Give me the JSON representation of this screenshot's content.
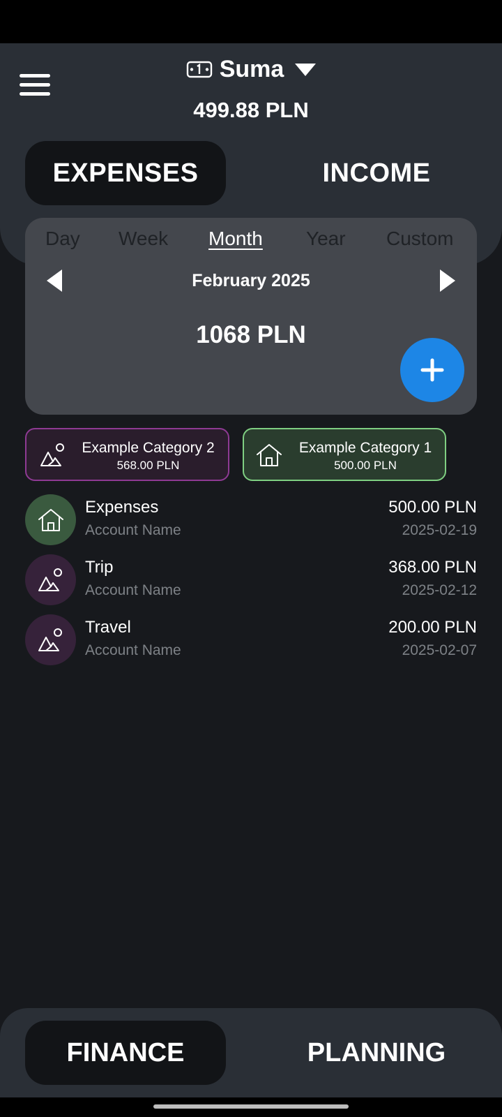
{
  "header": {
    "account_name": "Suma",
    "account_balance": "499.88 PLN",
    "wallet_icon": "wallet-icon",
    "tabs": [
      {
        "label": "EXPENSES",
        "active": true
      },
      {
        "label": "INCOME",
        "active": false
      }
    ]
  },
  "period": {
    "tabs": [
      "Day",
      "Week",
      "Month",
      "Year",
      "Custom"
    ],
    "active_tab": "Month",
    "label": "February 2025",
    "total": "1068 PLN"
  },
  "categories": [
    {
      "name": "Example Category 2",
      "amount": "568.00 PLN",
      "icon": "mountain-sun-icon",
      "color": "#8e3a93"
    },
    {
      "name": "Example Category 1",
      "amount": "500.00 PLN",
      "icon": "house-icon",
      "color": "#7fcf82"
    }
  ],
  "transactions": [
    {
      "title": "Expenses",
      "account": "Account Name",
      "amount": "500.00 PLN",
      "date": "2025-02-19",
      "icon": "house-icon"
    },
    {
      "title": "Trip",
      "account": "Account Name",
      "amount": "368.00 PLN",
      "date": "2025-02-12",
      "icon": "mountain-sun-icon"
    },
    {
      "title": "Travel",
      "account": "Account Name",
      "amount": "200.00 PLN",
      "date": "2025-02-07",
      "icon": "mountain-sun-icon"
    }
  ],
  "bottom_nav": {
    "tabs": [
      {
        "label": "FINANCE",
        "active": true
      },
      {
        "label": "PLANNING",
        "active": false
      }
    ]
  },
  "colors": {
    "accent": "#1d86e6",
    "header_bg": "#2a2f36",
    "background": "#17191d"
  }
}
